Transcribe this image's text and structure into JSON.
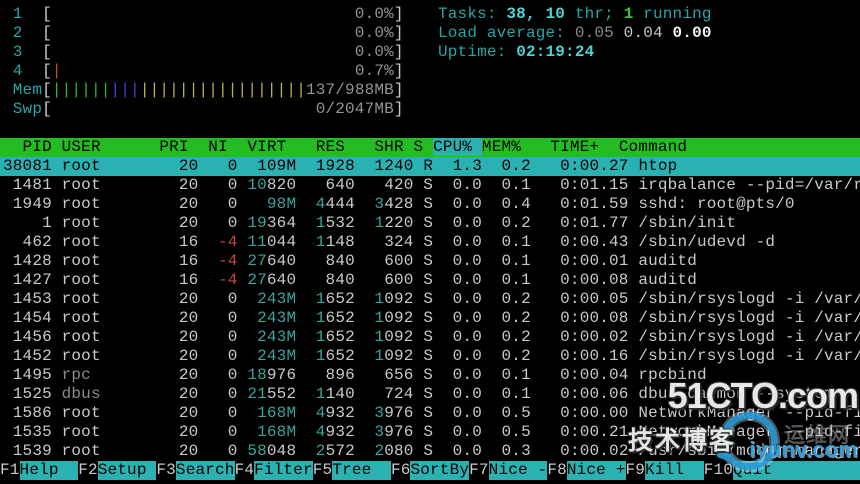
{
  "colors": {
    "bg": "#000000",
    "fg": "#c9c9c9",
    "dim": "#8a8a8a",
    "white_bright": "#f2f2f2",
    "cyan": "#26a5a5",
    "cyan_bright": "#4ed2d2",
    "green": "#3cc43c",
    "red": "#c74343",
    "teal_number": "#3ba39b",
    "meter_green": "#2db82d",
    "meter_blue": "#4343d8",
    "meter_yellow": "#b5b546",
    "bar_text": "#949494",
    "header_bg": "#23bc23",
    "selection_bg": "#2ab2b2",
    "watermark_blue": "#2e9fd9"
  },
  "meters": {
    "cpus": [
      {
        "label": "1",
        "percent": "0.0%",
        "red_pipes": 0
      },
      {
        "label": "2",
        "percent": "0.0%",
        "red_pipes": 0
      },
      {
        "label": "3",
        "percent": "0.0%",
        "red_pipes": 0
      },
      {
        "label": "4",
        "percent": "0.7%",
        "red_pipes": 1
      }
    ],
    "mem": {
      "label": "Mem",
      "text": "137/988MB",
      "green_pipes": 6,
      "blue_pipes": 3,
      "yellow_pipes": 17
    },
    "swp": {
      "label": "Swp",
      "text": "0/2047MB"
    }
  },
  "status": {
    "tasks_label": "Tasks: ",
    "tasks_count": "38, 10",
    "tasks_thr": " thr; ",
    "tasks_running_count": "1",
    "tasks_running_suffix": " running",
    "load_label": "Load average: ",
    "load_one": "0.05",
    "load_five": "0.04",
    "load_fifteen": "0.00",
    "uptime_label": "Uptime: ",
    "uptime_value": "02:19:24"
  },
  "table": {
    "columns": [
      "PID",
      "USER",
      "PRI",
      "NI",
      "VIRT",
      "RES",
      "SHR",
      "S",
      "CPU%",
      "MEM%",
      "TIME+",
      "Command"
    ],
    "sort_column": "CPU%",
    "rows": [
      {
        "pid": "38081",
        "user": "root",
        "pri": "20",
        "ni": "0",
        "virt": "109M",
        "res": "1928",
        "shr": "1240",
        "s": "R",
        "cpu": "1.3",
        "mem": "0.2",
        "time": "0:00.27",
        "cmd": "htop",
        "selected": true,
        "dim_user": false
      },
      {
        "pid": "1481",
        "user": "root",
        "pri": "20",
        "ni": "0",
        "virt": "10820",
        "res": "640",
        "shr": "420",
        "s": "S",
        "cpu": "0.0",
        "mem": "0.1",
        "time": "0:01.15",
        "cmd": "irqbalance --pid=/var/r",
        "selected": false,
        "dim_user": false
      },
      {
        "pid": "1949",
        "user": "root",
        "pri": "20",
        "ni": "0",
        "virt": "98M",
        "res": "4444",
        "shr": "3428",
        "s": "S",
        "cpu": "0.0",
        "mem": "0.4",
        "time": "0:01.59",
        "cmd": "sshd: root@pts/0",
        "selected": false,
        "dim_user": false
      },
      {
        "pid": "1",
        "user": "root",
        "pri": "20",
        "ni": "0",
        "virt": "19364",
        "res": "1532",
        "shr": "1220",
        "s": "S",
        "cpu": "0.0",
        "mem": "0.2",
        "time": "0:01.77",
        "cmd": "/sbin/init",
        "selected": false,
        "dim_user": false
      },
      {
        "pid": "462",
        "user": "root",
        "pri": "16",
        "ni": "-4",
        "virt": "11044",
        "res": "1148",
        "shr": "324",
        "s": "S",
        "cpu": "0.0",
        "mem": "0.1",
        "time": "0:00.43",
        "cmd": "/sbin/udevd -d",
        "selected": false,
        "dim_user": false
      },
      {
        "pid": "1428",
        "user": "root",
        "pri": "16",
        "ni": "-4",
        "virt": "27640",
        "res": "840",
        "shr": "600",
        "s": "S",
        "cpu": "0.0",
        "mem": "0.1",
        "time": "0:00.01",
        "cmd": "auditd",
        "selected": false,
        "dim_user": false
      },
      {
        "pid": "1427",
        "user": "root",
        "pri": "16",
        "ni": "-4",
        "virt": "27640",
        "res": "840",
        "shr": "600",
        "s": "S",
        "cpu": "0.0",
        "mem": "0.1",
        "time": "0:00.08",
        "cmd": "auditd",
        "selected": false,
        "dim_user": false
      },
      {
        "pid": "1453",
        "user": "root",
        "pri": "20",
        "ni": "0",
        "virt": "243M",
        "res": "1652",
        "shr": "1092",
        "s": "S",
        "cpu": "0.0",
        "mem": "0.2",
        "time": "0:00.05",
        "cmd": "/sbin/rsyslogd -i /var/",
        "selected": false,
        "dim_user": false
      },
      {
        "pid": "1454",
        "user": "root",
        "pri": "20",
        "ni": "0",
        "virt": "243M",
        "res": "1652",
        "shr": "1092",
        "s": "S",
        "cpu": "0.0",
        "mem": "0.2",
        "time": "0:00.08",
        "cmd": "/sbin/rsyslogd -i /var/",
        "selected": false,
        "dim_user": false
      },
      {
        "pid": "1456",
        "user": "root",
        "pri": "20",
        "ni": "0",
        "virt": "243M",
        "res": "1652",
        "shr": "1092",
        "s": "S",
        "cpu": "0.0",
        "mem": "0.2",
        "time": "0:00.02",
        "cmd": "/sbin/rsyslogd -i /var/",
        "selected": false,
        "dim_user": false
      },
      {
        "pid": "1452",
        "user": "root",
        "pri": "20",
        "ni": "0",
        "virt": "243M",
        "res": "1652",
        "shr": "1092",
        "s": "S",
        "cpu": "0.0",
        "mem": "0.2",
        "time": "0:00.16",
        "cmd": "/sbin/rsyslogd -i /var/",
        "selected": false,
        "dim_user": false
      },
      {
        "pid": "1495",
        "user": "rpc",
        "pri": "20",
        "ni": "0",
        "virt": "18976",
        "res": "896",
        "shr": "656",
        "s": "S",
        "cpu": "0.0",
        "mem": "0.1",
        "time": "0:00.04",
        "cmd": "rpcbind",
        "selected": false,
        "dim_user": true
      },
      {
        "pid": "1525",
        "user": "dbus",
        "pri": "20",
        "ni": "0",
        "virt": "21552",
        "res": "1140",
        "shr": "724",
        "s": "S",
        "cpu": "0.0",
        "mem": "0.1",
        "time": "0:00.06",
        "cmd": "dbus-daemon --system",
        "selected": false,
        "dim_user": true
      },
      {
        "pid": "1586",
        "user": "root",
        "pri": "20",
        "ni": "0",
        "virt": "168M",
        "res": "4932",
        "shr": "3976",
        "s": "S",
        "cpu": "0.0",
        "mem": "0.5",
        "time": "0:00.00",
        "cmd": "NetworkManager --pid-fi",
        "selected": false,
        "dim_user": false
      },
      {
        "pid": "1535",
        "user": "root",
        "pri": "20",
        "ni": "0",
        "virt": "168M",
        "res": "4932",
        "shr": "3976",
        "s": "S",
        "cpu": "0.0",
        "mem": "0.5",
        "time": "0:00.21",
        "cmd": "NetworkManager --pid-fi",
        "selected": false,
        "dim_user": false
      },
      {
        "pid": "1539",
        "user": "root",
        "pri": "20",
        "ni": "0",
        "virt": "58048",
        "res": "2572",
        "shr": "2080",
        "s": "S",
        "cpu": "0.0",
        "mem": "0.3",
        "time": "0:00.02",
        "cmd": "/usr/sbin/modem-manager",
        "selected": false,
        "dim_user": false
      }
    ]
  },
  "function_bar": [
    {
      "key": "F1",
      "label": "Help"
    },
    {
      "key": "F2",
      "label": "Setup"
    },
    {
      "key": "F3",
      "label": "Search"
    },
    {
      "key": "F4",
      "label": "Filter"
    },
    {
      "key": "F5",
      "label": "Tree"
    },
    {
      "key": "F6",
      "label": "SortBy"
    },
    {
      "key": "F7",
      "label": "Nice -"
    },
    {
      "key": "F8",
      "label": "Nice +"
    },
    {
      "key": "F9",
      "label": "Kill"
    },
    {
      "key": "F10",
      "label": "Quit"
    }
  ],
  "watermark": {
    "site": "51CTO.com",
    "tech_blog": "技术博客",
    "faint": "运维网",
    "iyunv": "iyunv.com"
  }
}
